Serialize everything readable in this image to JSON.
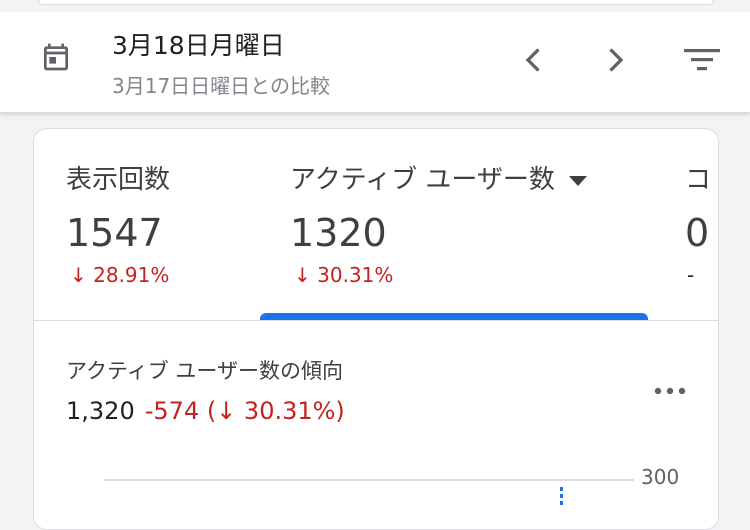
{
  "header": {
    "date": "3月18日月曜日",
    "comparison": "3月17日日曜日との比較",
    "icons": {
      "calendar": "calendar-icon",
      "prev": "chevron-left-icon",
      "next": "chevron-right-icon",
      "filter": "filter-icon"
    }
  },
  "metrics": [
    {
      "label": "表示回数",
      "value": "1547",
      "change": "↓ 28.91%"
    },
    {
      "label": "アクティブ ユーザー数",
      "value": "1320",
      "change": "↓ 30.31%",
      "selected": true
    },
    {
      "label": "コ",
      "value": "0",
      "change": "-"
    }
  ],
  "trend": {
    "title": "アクティブ ユーザー数の傾向",
    "value": "1,320",
    "delta": "-574 (↓ 30.31%)",
    "y_tick": "300",
    "more_icon": "more-horizontal-icon"
  },
  "colors": {
    "accent": "#1a73e8",
    "negative": "#c5221f",
    "text": "#3c4043",
    "muted": "#80868b"
  }
}
